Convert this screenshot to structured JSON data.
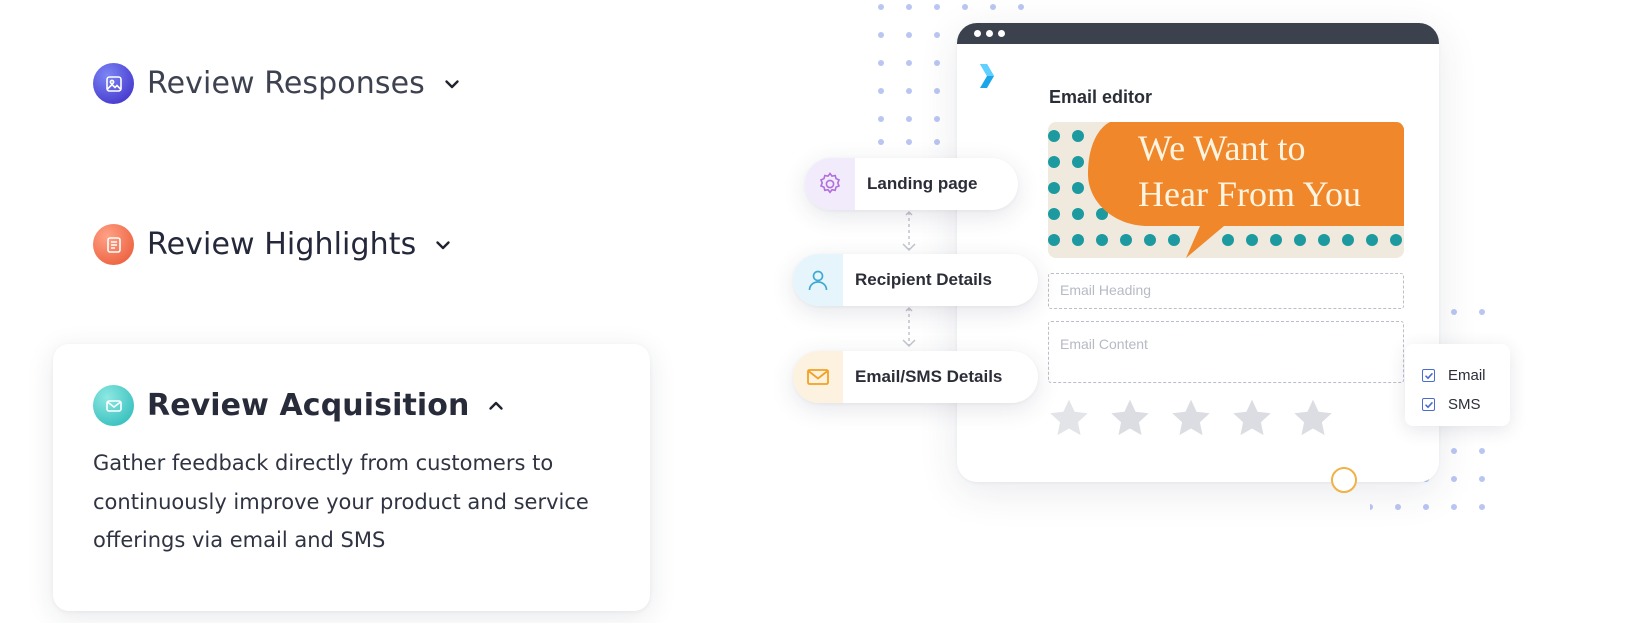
{
  "accordion": {
    "items": [
      {
        "title": "Review Responses",
        "icon": "image-icon",
        "expanded": false,
        "accent": "#5a4fe0"
      },
      {
        "title": "Review Highlights",
        "icon": "document-icon",
        "expanded": false,
        "accent": "#f07552"
      },
      {
        "title": "Review Acquisition",
        "icon": "mail-icon",
        "expanded": true,
        "accent": "#45c6c4",
        "description": "Gather feedback directly from customers to continuously improve your product and service offerings via email and SMS"
      }
    ]
  },
  "illustration": {
    "editor": {
      "title": "Email editor",
      "banner_text": [
        "We Want to",
        "Hear From You"
      ],
      "heading_placeholder": "Email Heading",
      "content_placeholder": "Email Content",
      "stars": 5
    },
    "steps": [
      {
        "label": "Landing page",
        "icon": "gear-icon"
      },
      {
        "label": "Recipient Details",
        "icon": "user-icon"
      },
      {
        "label": "Email/SMS Details",
        "icon": "envelope-icon"
      }
    ],
    "channels": [
      {
        "label": "Email",
        "checked": true
      },
      {
        "label": "SMS",
        "checked": true
      }
    ],
    "colors": {
      "banner_orange": "#f0872a",
      "banner_teal": "#1d9aa0",
      "editor_bar": "#3b414d",
      "check_blue": "#4b6bd1"
    }
  }
}
